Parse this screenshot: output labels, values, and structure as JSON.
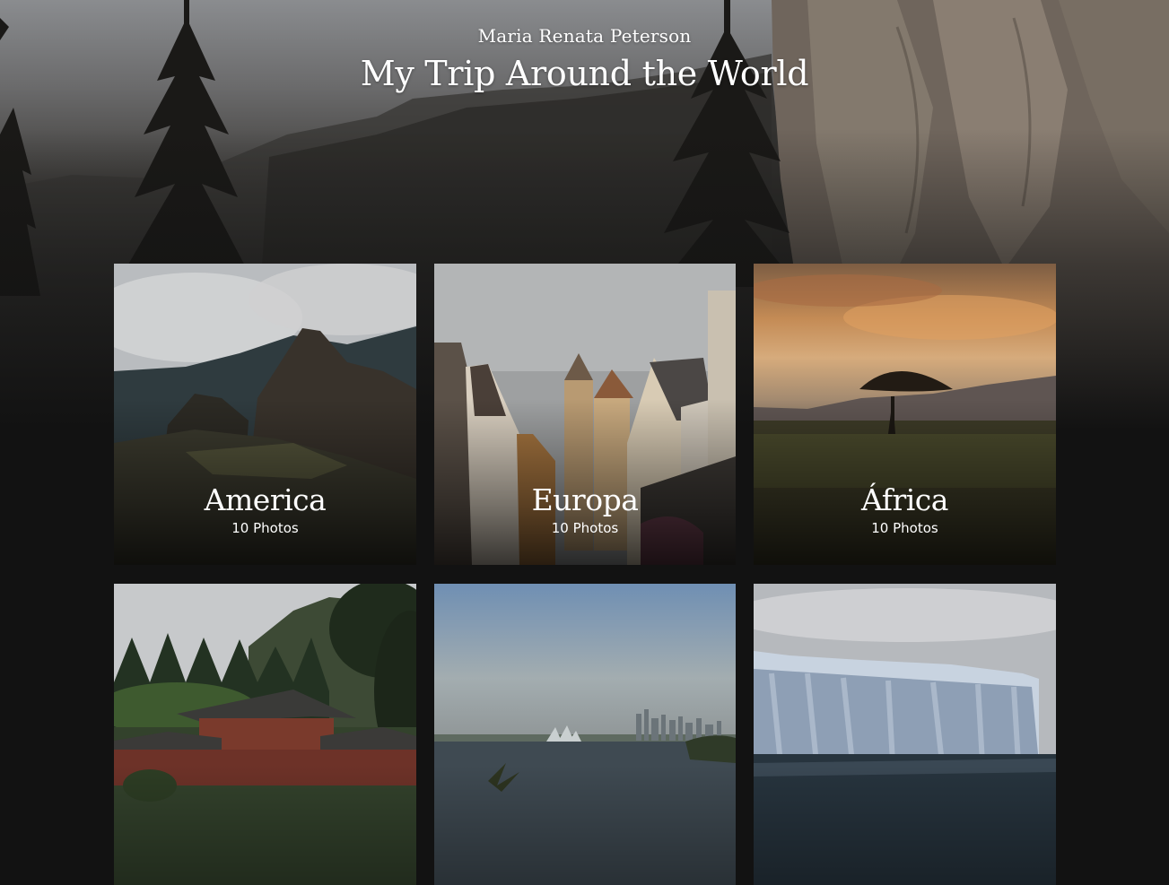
{
  "header": {
    "author": "Maria Renata Peterson",
    "title": "My Trip Around the World"
  },
  "albums": [
    {
      "name": "America",
      "count": "10 Photos"
    },
    {
      "name": "Europa",
      "count": "10 Photos"
    },
    {
      "name": "África",
      "count": "10 Photos"
    },
    {
      "name": "",
      "count": ""
    },
    {
      "name": "",
      "count": ""
    },
    {
      "name": "",
      "count": ""
    }
  ]
}
